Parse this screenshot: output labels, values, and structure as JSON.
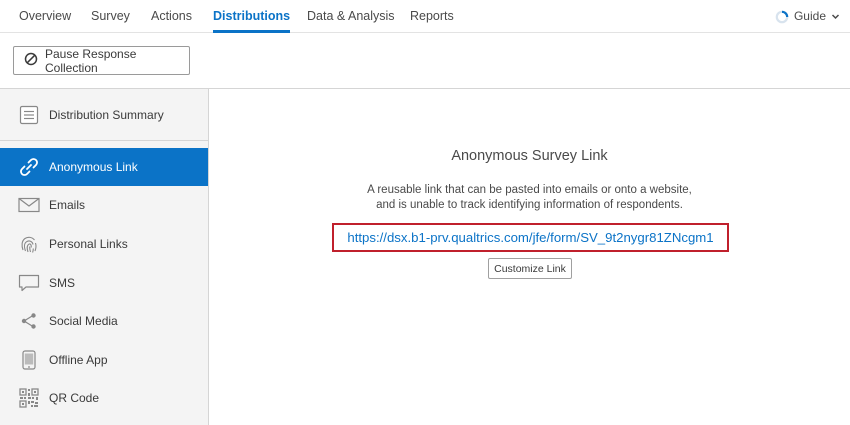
{
  "nav": {
    "tabs": [
      {
        "label": "Overview"
      },
      {
        "label": "Survey"
      },
      {
        "label": "Actions"
      },
      {
        "label": "Distributions"
      },
      {
        "label": "Data & Analysis"
      },
      {
        "label": "Reports"
      }
    ],
    "active_tab": "Distributions",
    "guide_label": "Guide"
  },
  "toolbar": {
    "pause_label": "Pause Response Collection"
  },
  "sidebar": {
    "items": [
      {
        "label": "Distribution Summary",
        "icon": "list-icon"
      },
      {
        "label": "Anonymous Link",
        "icon": "link-icon"
      },
      {
        "label": "Emails",
        "icon": "envelope-icon"
      },
      {
        "label": "Personal Links",
        "icon": "fingerprint-icon"
      },
      {
        "label": "SMS",
        "icon": "chat-bubble-icon"
      },
      {
        "label": "Social Media",
        "icon": "share-icon"
      },
      {
        "label": "Offline App",
        "icon": "phone-icon"
      },
      {
        "label": "QR Code",
        "icon": "qr-code-icon"
      }
    ],
    "active_item": "Anonymous Link"
  },
  "main": {
    "title": "Anonymous Survey Link",
    "description_line1": "A reusable link that can be pasted into emails or onto a website,",
    "description_line2": "and is unable to track identifying information of respondents.",
    "survey_link": "https://dsx.b1-prv.qualtrics.com/jfe/form/SV_9t2nygr81ZNcgm1",
    "customize_label": "Customize Link"
  },
  "colors": {
    "accent": "#0b73c7",
    "highlight_border": "#c0202c",
    "sidebar_bg": "#f4f4f4"
  }
}
